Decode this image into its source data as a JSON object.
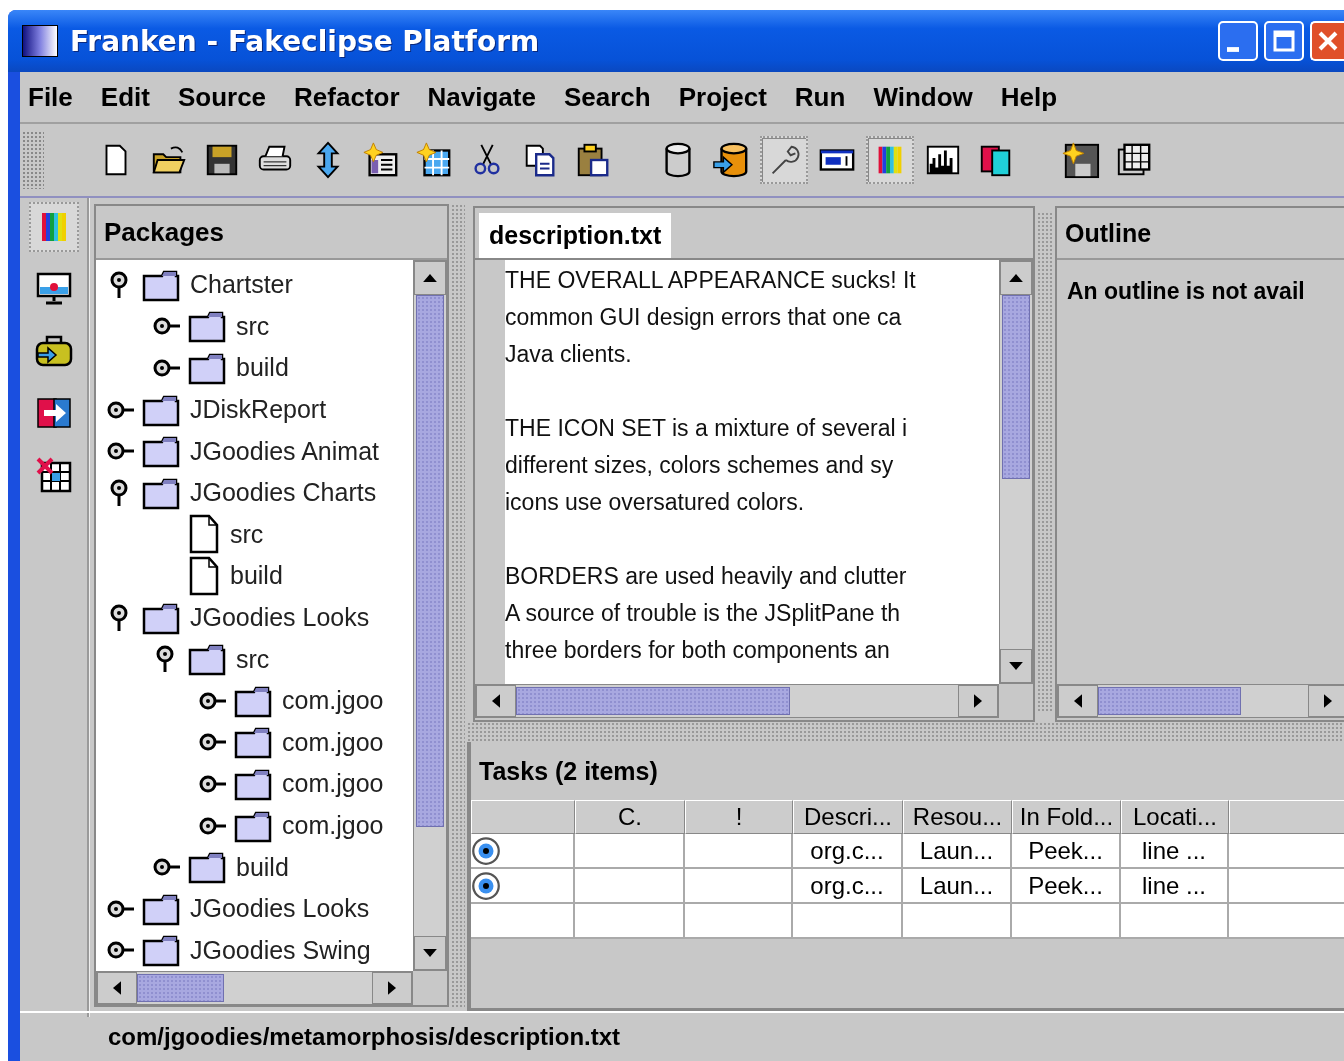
{
  "window": {
    "title": "Franken - Fakeclipse Platform"
  },
  "menu": [
    "File",
    "Edit",
    "Source",
    "Refactor",
    "Navigate",
    "Search",
    "Project",
    "Run",
    "Window",
    "Help"
  ],
  "toolbar": [
    {
      "kind": "new-file",
      "selected": false
    },
    {
      "kind": "open-folder",
      "selected": false
    },
    {
      "kind": "save",
      "selected": false
    },
    {
      "kind": "print",
      "selected": false
    },
    {
      "kind": "up-down",
      "selected": false
    },
    {
      "kind": "new-card",
      "selected": false
    },
    {
      "kind": "new-grid",
      "selected": false
    },
    {
      "kind": "cut",
      "selected": false
    },
    {
      "kind": "copy",
      "selected": false
    },
    {
      "kind": "paste",
      "selected": false
    },
    {
      "kind": "separator"
    },
    {
      "kind": "cylinder",
      "selected": false
    },
    {
      "kind": "import-cylinder",
      "selected": false
    },
    {
      "kind": "wrench",
      "selected": true
    },
    {
      "kind": "widget",
      "selected": false
    },
    {
      "kind": "color-bars",
      "selected": true
    },
    {
      "kind": "bar-chart",
      "selected": false
    },
    {
      "kind": "two-panes",
      "selected": false
    },
    {
      "kind": "separator"
    },
    {
      "kind": "save-star",
      "selected": false
    },
    {
      "kind": "grid-stack",
      "selected": false
    }
  ],
  "perspectives": [
    {
      "kind": "color-bars",
      "selected": true
    },
    {
      "kind": "monitor",
      "selected": false
    },
    {
      "kind": "briefcase",
      "selected": false
    },
    {
      "kind": "exit",
      "selected": false
    },
    {
      "kind": "table-delete",
      "selected": false
    }
  ],
  "packages": {
    "title": "Packages",
    "tree": [
      {
        "label": "Chartster",
        "kind": "folder",
        "expanded": true,
        "children": [
          {
            "label": "src",
            "kind": "folder",
            "expanded": false
          },
          {
            "label": "build",
            "kind": "folder",
            "expanded": false
          }
        ]
      },
      {
        "label": "JDiskReport",
        "kind": "folder",
        "expanded": false
      },
      {
        "label": "JGoodies Animat",
        "kind": "folder",
        "expanded": false
      },
      {
        "label": "JGoodies Charts",
        "kind": "folder",
        "expanded": true,
        "children": [
          {
            "label": "src",
            "kind": "file"
          },
          {
            "label": "build",
            "kind": "file"
          }
        ]
      },
      {
        "label": "JGoodies Looks",
        "kind": "folder",
        "expanded": true,
        "children": [
          {
            "label": "src",
            "kind": "folder",
            "expanded": true,
            "children": [
              {
                "label": "com.jgoo",
                "kind": "folder",
                "expanded": false
              },
              {
                "label": "com.jgoo",
                "kind": "folder",
                "expanded": false
              },
              {
                "label": "com.jgoo",
                "kind": "folder",
                "expanded": false
              },
              {
                "label": "com.jgoo",
                "kind": "folder",
                "expanded": false
              }
            ]
          },
          {
            "label": "build",
            "kind": "folder",
            "expanded": false
          }
        ]
      },
      {
        "label": "JGoodies Looks",
        "kind": "folder",
        "expanded": false
      },
      {
        "label": "JGoodies Swing",
        "kind": "folder",
        "expanded": false
      }
    ]
  },
  "editor": {
    "tabs": [
      {
        "label": "description.txt",
        "selected": true
      }
    ],
    "paragraphs": [
      [
        "THE OVERALL APPEARANCE sucks! It",
        "common GUI design errors that one ca",
        "Java clients."
      ],
      [
        "THE ICON SET is a mixture of several i",
        "different sizes, colors schemes and sy",
        "icons use oversatured colors."
      ],
      [
        "BORDERS are used heavily and clutter",
        "A source of trouble is the JSplitPane th",
        "three borders for both components an"
      ]
    ]
  },
  "outline": {
    "title": "Outline",
    "message": "An outline is not avail"
  },
  "tasks": {
    "title": "Tasks (2 items)",
    "columns": [
      "C.",
      "!",
      "Descri...",
      "Resou...",
      "In Fold...",
      "Locati..."
    ],
    "rows": [
      {
        "kind": "eye",
        "cells": [
          null,
          null,
          "org.c...",
          "Laun...",
          "Peek...",
          "line ..."
        ]
      },
      {
        "kind": "eye",
        "cells": [
          null,
          null,
          "org.c...",
          "Laun...",
          "Peek...",
          "line ..."
        ]
      }
    ]
  },
  "status_bar": {
    "path": "com/jgoodies/metamorphosis/description.txt"
  }
}
